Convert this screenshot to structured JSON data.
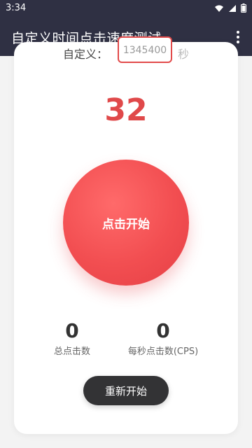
{
  "status_bar": {
    "time": "3:34",
    "icons": [
      "wifi-icon",
      "signal-icon",
      "battery-icon"
    ]
  },
  "app_bar": {
    "title": "自定义时间点击速度测试",
    "menu_icon": "more-vert-icon"
  },
  "custom_time": {
    "label": "自定义：",
    "value": "1345400",
    "unit": "秒"
  },
  "timer": {
    "value": "32"
  },
  "main_button": {
    "label": "点击开始"
  },
  "stats": {
    "total_clicks_value": "0",
    "total_clicks_label": "总点击数",
    "cps_value": "0",
    "cps_label": "每秒点击数(CPS)"
  },
  "restart_button": {
    "label": "重新开始"
  },
  "colors": {
    "header_bg": "#2f3043",
    "accent_red": "#e0494a",
    "dark_button": "#333335"
  }
}
